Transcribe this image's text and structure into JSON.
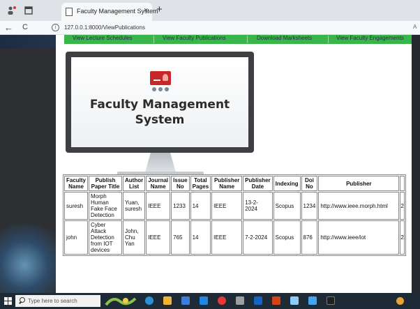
{
  "browser": {
    "tab_title": "Faculty Management System",
    "tab_close": "×",
    "new_tab": "+",
    "back": "←",
    "reload": "C",
    "info": "i",
    "url": "127.0.0.1:8000/ViewPublications",
    "url_trailing": "A"
  },
  "menu": {
    "items": [
      "View Lecture Schedules",
      "View Faculty Publications",
      "Download Marksheets",
      "View Faculty Engagements"
    ]
  },
  "hero": {
    "line1": "Faculty Management",
    "line2": "System"
  },
  "table": {
    "headers": [
      "Faculty Name",
      "Publish Paper Title",
      "Author List",
      "Journal Name",
      "Issue No",
      "Total Pages",
      "Publisher Name",
      "Publisher Date",
      "Indexing",
      "Doi No",
      "Publisher",
      ""
    ],
    "rows": [
      [
        "suresh",
        "Morph Human Fake Face Detection",
        "Yuan, suresh",
        "IEEE",
        "1233",
        "14",
        "IEEE",
        "13-2-2024",
        "Scopus",
        "1234",
        "http://www.ieee.morph.html",
        "2"
      ],
      [
        "john",
        "Cyber Attack Detection from IOT devices",
        "John, Chu Yan",
        "IEEE",
        "765",
        "14",
        "IEEE",
        "7-2-2024",
        "Scopus",
        "876",
        "http://www.ieee/iot",
        "2"
      ]
    ]
  },
  "taskbar": {
    "search_placeholder": "Type here to search"
  },
  "colors": {
    "menu_green": "#3ab54a",
    "logo_red": "#c62828",
    "taskbar": "#1f2a37"
  }
}
